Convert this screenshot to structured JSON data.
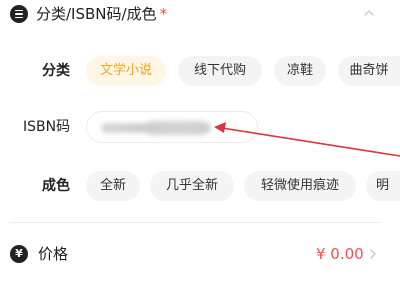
{
  "category_section": {
    "title": "分类/ISBN码/成色",
    "required_mark": "*",
    "icon": "list-icon",
    "collapse_icon": "chevron-up-icon"
  },
  "category_row": {
    "label": "分类",
    "options": [
      "文学小说",
      "线下代购",
      "凉鞋",
      "曲奇饼"
    ],
    "selected": "文学小说"
  },
  "isbn_row": {
    "label": "ISBN码",
    "value": ""
  },
  "condition_row": {
    "label": "成色",
    "options": [
      "全新",
      "几乎全新",
      "轻微使用痕迹",
      "明"
    ]
  },
  "price_row": {
    "icon": "yen-circle-icon",
    "icon_glyph": "¥",
    "label": "价格",
    "value": "¥ 0.00",
    "chevron_icon": "chevron-right-icon"
  },
  "colors": {
    "selected_chip_bg": "#fff6e5",
    "selected_chip_text": "#f5a623",
    "price_text": "#ff4d4f",
    "required_star": "#ff4444",
    "annotation_arrow": "#d9363e"
  }
}
